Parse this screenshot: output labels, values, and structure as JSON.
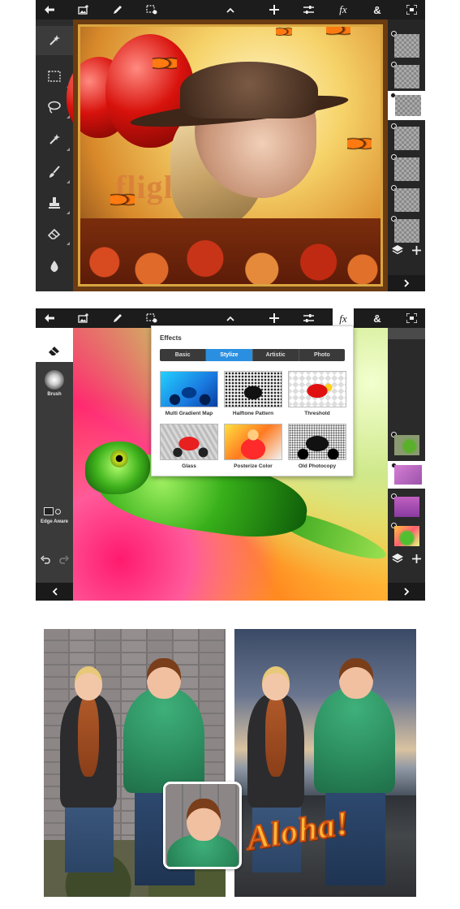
{
  "screen1": {
    "canvas_text": "flight",
    "layer_count": 7,
    "selected_layer_index": 2
  },
  "screen2": {
    "effects": {
      "title": "Effects",
      "tabs": [
        "Basic",
        "Stylize",
        "Artistic",
        "Photo"
      ],
      "active_tab": "Stylize",
      "items": [
        {
          "label": "Multi Gradient Map"
        },
        {
          "label": "Halftone Pattern"
        },
        {
          "label": "Threshold"
        },
        {
          "label": "Glass"
        },
        {
          "label": "Posterize Color"
        },
        {
          "label": "Old Photocopy"
        }
      ]
    },
    "tool_panel": {
      "brush_label": "Brush",
      "edge_aware_label": "Edge Aware"
    }
  },
  "comparison": {
    "overlay_text": "Aloha!"
  },
  "colors": {
    "toolbar_bg": "#1c1c1c",
    "panel_bg": "#2c2c2c",
    "accent_blue": "#2a8fe0",
    "aloha_fill": "#ffb63a",
    "aloha_stroke": "#c94e10"
  }
}
